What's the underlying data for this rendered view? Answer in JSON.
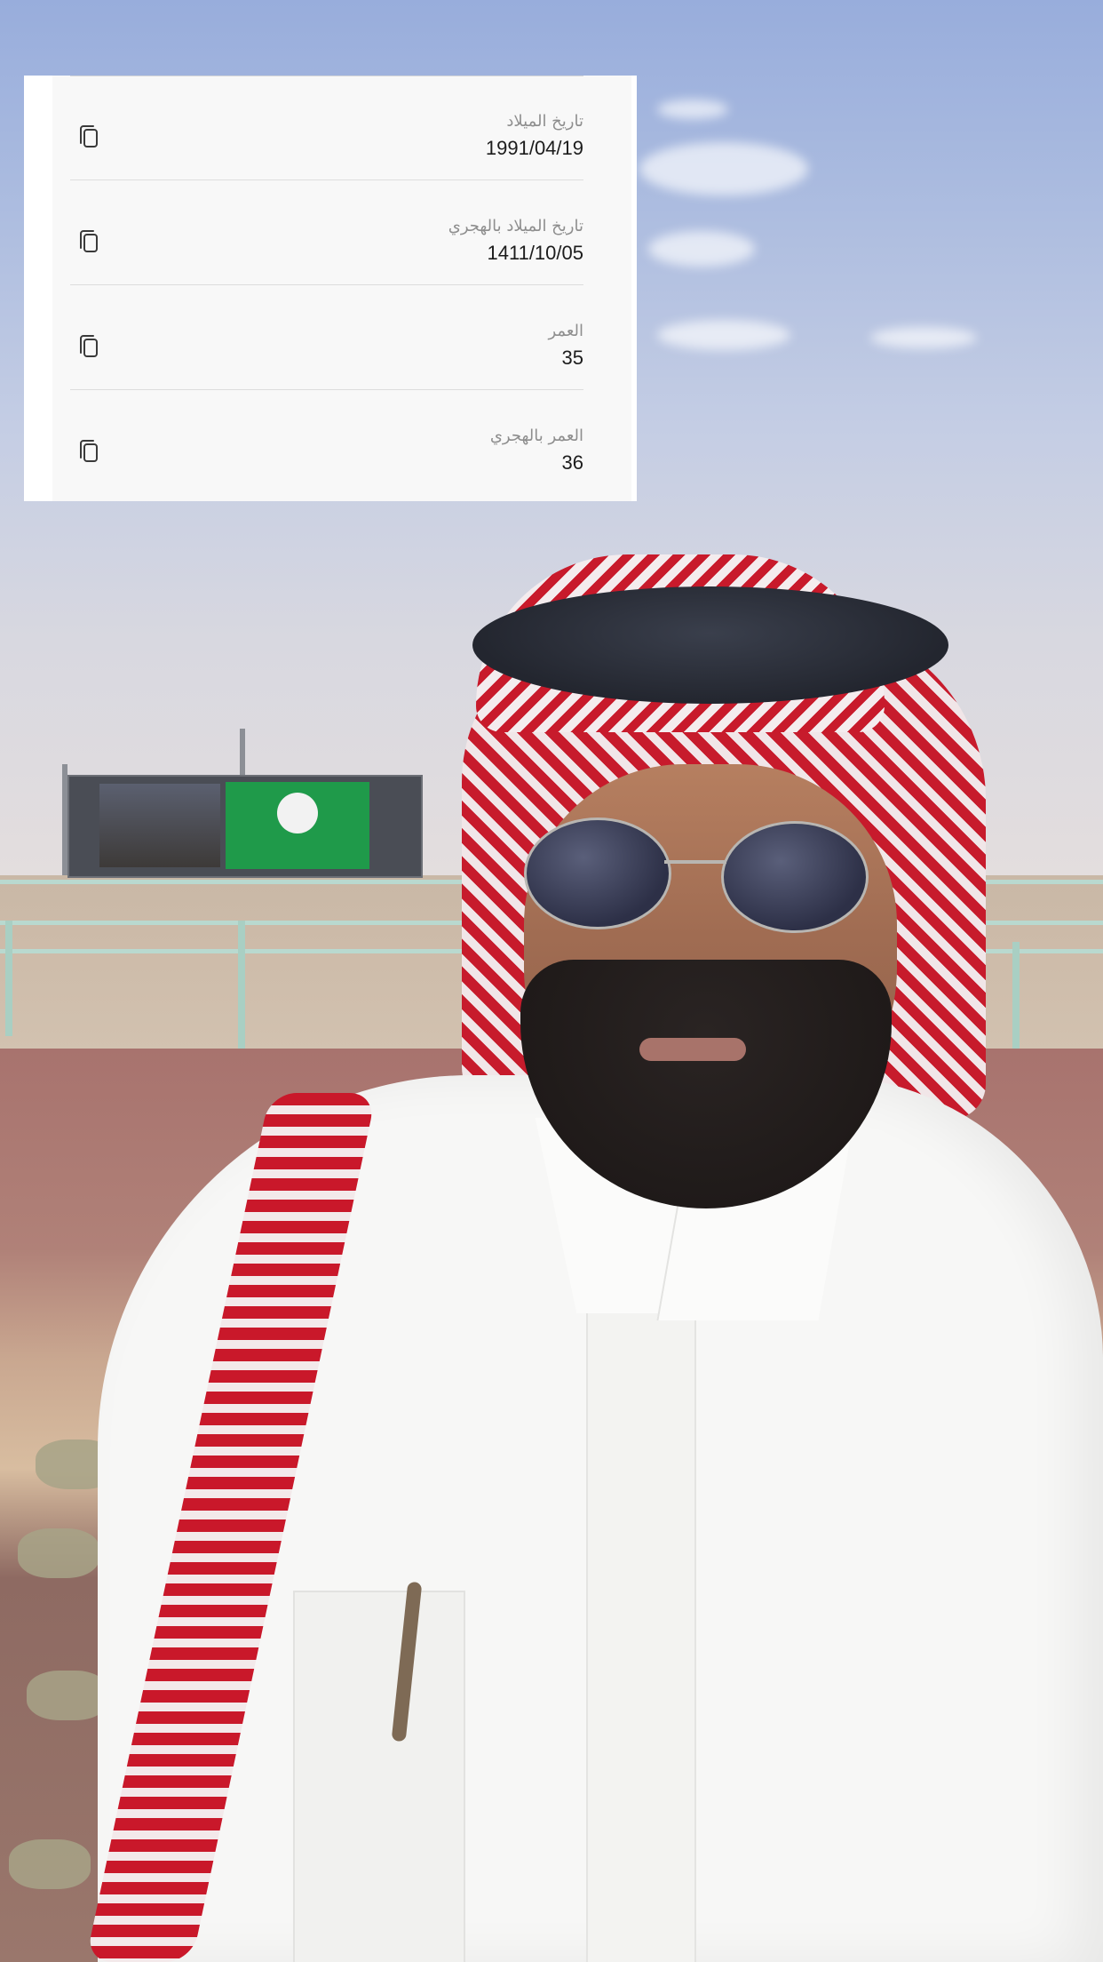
{
  "info_card": {
    "rows": [
      {
        "label": "تاريخ الميلاد",
        "value": "1991/04/19",
        "action_icon": "copy-icon"
      },
      {
        "label": "تاريخ الميلاد بالهجري",
        "value": "1411/10/05",
        "action_icon": "copy-icon"
      },
      {
        "label": "العمر",
        "value": "35",
        "action_icon": "copy-icon"
      },
      {
        "label": "العمر بالهجري",
        "value": "36",
        "action_icon": "copy-icon"
      }
    ]
  },
  "colors": {
    "card_background": "#f8f8f8",
    "label_gray": "#8e8e8e",
    "value_dark": "#1c1c1c",
    "divider": "#dddddd"
  }
}
